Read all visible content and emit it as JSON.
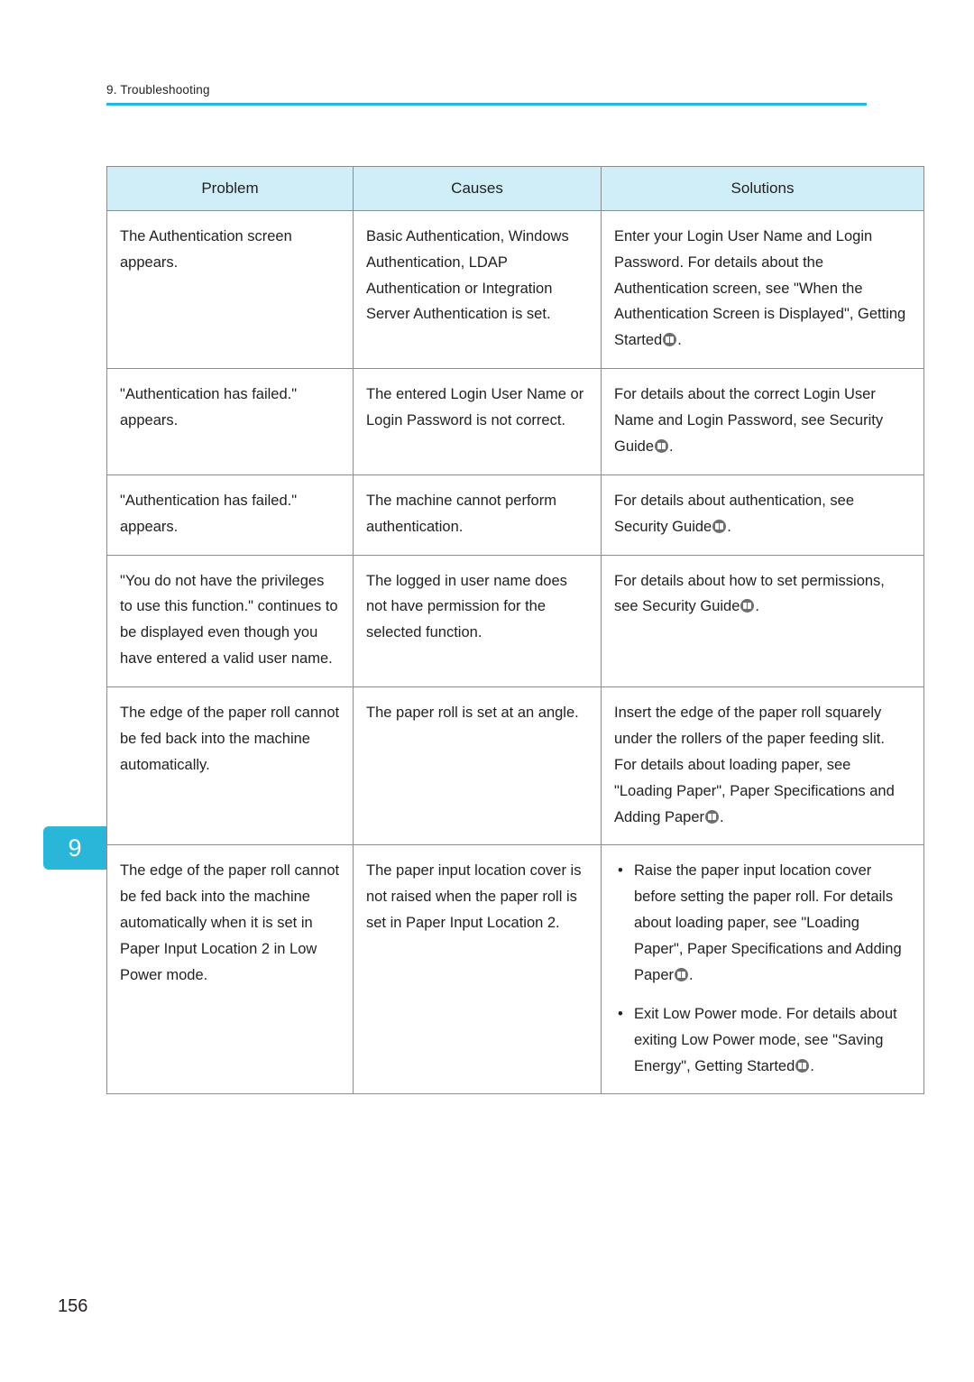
{
  "header": {
    "chapter_label": "9. Troubleshooting",
    "rule_color": "#29b6d8"
  },
  "chapter_tab": {
    "number": "9",
    "color": "#29b6d8"
  },
  "page_number": "156",
  "table": {
    "headers": {
      "problem": "Problem",
      "causes": "Causes",
      "solutions": "Solutions"
    },
    "header_bg": "#cfeef7",
    "rows": [
      {
        "problem": "The Authentication screen appears.",
        "causes": "Basic Authentication, Windows Authentication, LDAP Authentication or Integration Server Authentication is set.",
        "solution_pre": "Enter your Login User Name and Login Password. For details about the Authentication screen, see \"When the Authentication Screen is Displayed\", Getting Started",
        "solution_post": "."
      },
      {
        "problem": "\"Authentication has failed.\" appears.",
        "causes": "The entered Login User Name or Login Password is not correct.",
        "solution_pre": "For details about the correct Login User Name and Login Password, see Security Guide",
        "solution_post": "."
      },
      {
        "problem": "\"Authentication has failed.\" appears.",
        "causes": "The machine cannot perform authentication.",
        "solution_pre": "For details about authentication, see Security Guide",
        "solution_post": "."
      },
      {
        "problem": "\"You do not have the privileges to use this function.\" continues to be displayed even though you have entered a valid user name.",
        "causes": "The logged in user name does not have permission for the selected function.",
        "solution_pre": "For details about how to set permissions, see Security Guide",
        "solution_post": "."
      },
      {
        "problem": "The edge of the paper roll cannot be fed back into the machine automatically.",
        "causes": "The paper roll is set at an angle.",
        "solution_pre": "Insert the edge of the paper roll squarely under the rollers of the paper feeding slit. For details about loading paper, see \"Loading Paper\", Paper Specifications and Adding Paper",
        "solution_post": "."
      }
    ],
    "last_row": {
      "problem": "The edge of the paper roll cannot be fed back into the machine automatically when it is set in Paper Input Location 2 in Low Power mode.",
      "causes": "The paper input location cover is not raised when the paper roll is set in Paper Input Location 2.",
      "solution_bullets": [
        {
          "pre": "Raise the paper input location cover before setting the paper roll. For details about loading paper, see \"Loading Paper\", Paper Specifications and Adding Paper",
          "post": "."
        },
        {
          "pre": "Exit Low Power mode. For details about exiting Low Power mode, see \"Saving Energy\", Getting Started",
          "post": "."
        }
      ]
    }
  }
}
